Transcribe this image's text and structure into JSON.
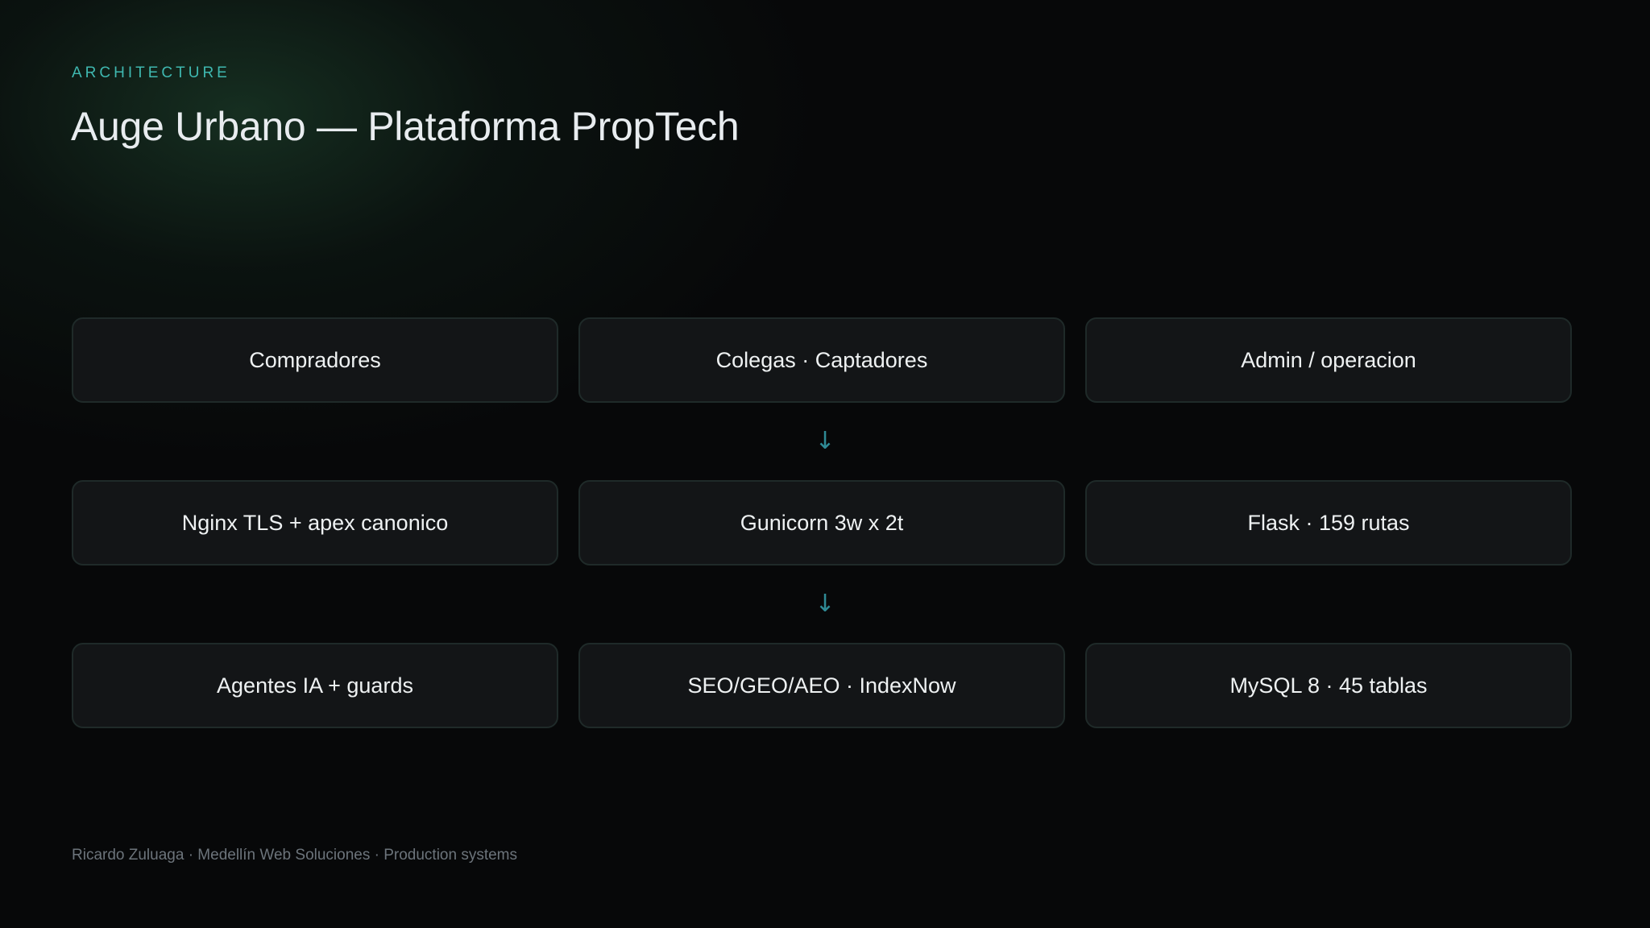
{
  "header": {
    "eyebrow": "ARCHITECTURE",
    "title": "Auge Urbano — Plataforma PropTech"
  },
  "rows": [
    {
      "boxes": [
        "Compradores",
        "Colegas · Captadores",
        "Admin / operacion"
      ]
    },
    {
      "boxes": [
        "Nginx TLS + apex canonico",
        "Gunicorn 3w x 2t",
        "Flask · 159 rutas"
      ]
    },
    {
      "boxes": [
        "Agentes IA + guards",
        "SEO/GEO/AEO · IndexNow",
        "MySQL 8 · 45 tablas"
      ]
    }
  ],
  "connector_glyph": "↓",
  "footer": {
    "text": "Ricardo Zuluaga · Medellín Web Soluciones · Production systems"
  },
  "colors": {
    "background": "#070809",
    "accent": "#3fb8b0",
    "arrow": "#2f8a95",
    "box_bg": "#131517",
    "box_border": "#1f2a29"
  }
}
